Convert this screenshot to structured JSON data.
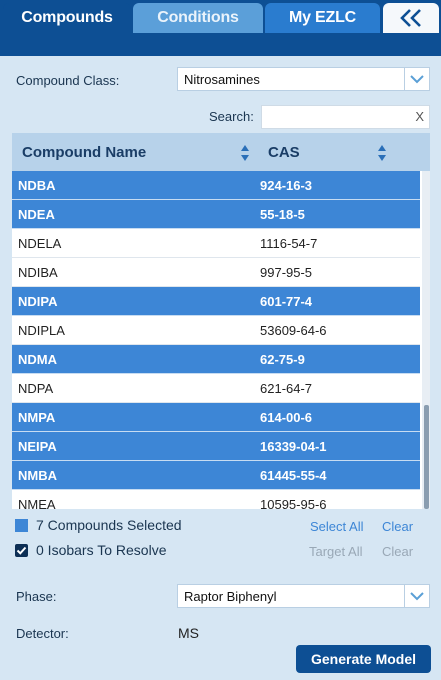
{
  "tabs": [
    {
      "label": "Compounds"
    },
    {
      "label": "Conditions"
    },
    {
      "label": "My EZLC"
    }
  ],
  "collapse_icon": "double-chevron-left-icon",
  "compound_class": {
    "label": "Compound Class:",
    "value": "Nitrosamines"
  },
  "search": {
    "label": "Search:",
    "value": "",
    "clear": "X"
  },
  "table": {
    "headers": [
      "Compound Name",
      "CAS"
    ],
    "rows": [
      {
        "name": "NDBA",
        "cas": "924-16-3",
        "selected": true
      },
      {
        "name": "NDEA",
        "cas": "55-18-5",
        "selected": true
      },
      {
        "name": "NDELA",
        "cas": "1116-54-7",
        "selected": false
      },
      {
        "name": "NDIBA",
        "cas": "997-95-5",
        "selected": false
      },
      {
        "name": "NDIPA",
        "cas": "601-77-4",
        "selected": true
      },
      {
        "name": "NDIPLA",
        "cas": "53609-64-6",
        "selected": false
      },
      {
        "name": "NDMA",
        "cas": "62-75-9",
        "selected": true
      },
      {
        "name": "NDPA",
        "cas": "621-64-7",
        "selected": false
      },
      {
        "name": "NMPA",
        "cas": "614-00-6",
        "selected": true
      },
      {
        "name": "NEIPA",
        "cas": "16339-04-1",
        "selected": true
      },
      {
        "name": "NMBA",
        "cas": "61445-55-4",
        "selected": true
      },
      {
        "name": "NMEA",
        "cas": "10595-95-6",
        "selected": false
      }
    ]
  },
  "summary": {
    "selected_text": "7 Compounds Selected",
    "isobars_text": "0 Isobars To Resolve",
    "select_all": "Select All",
    "clear1": "Clear",
    "target_all": "Target All",
    "clear2": "Clear"
  },
  "phase": {
    "label": "Phase:",
    "value": "Raptor Biphenyl"
  },
  "detector": {
    "label": "Detector:",
    "value": "MS"
  },
  "generate_button": "Generate Model",
  "colors": {
    "primary": "#0d4f94",
    "selected_row": "#3d86d6",
    "header": "#b7d2ea",
    "background": "#d6e6f3"
  }
}
